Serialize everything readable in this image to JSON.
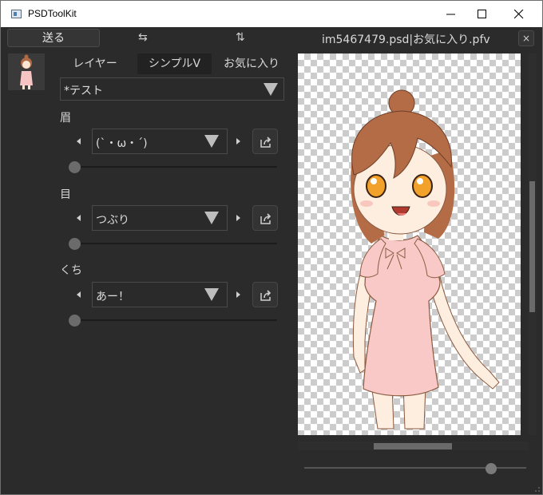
{
  "window": {
    "title": "PSDToolKit"
  },
  "toolbar": {
    "send_label": "送る",
    "swap_horizontal_glyph": "⇆",
    "swap_vertical_glyph": "⇅",
    "file_title": "im5467479.psd|お気に入り.pfv",
    "close_glyph": "×"
  },
  "tabs": [
    {
      "label": "レイヤー"
    },
    {
      "label": "シンプルV"
    },
    {
      "label": "お気に入り"
    }
  ],
  "preset": {
    "value": "*テスト"
  },
  "sections": [
    {
      "label": "眉",
      "value": "(`・ω・´)",
      "slider": 0
    },
    {
      "label": "目",
      "value": "つぶり",
      "slider": 0
    },
    {
      "label": "くち",
      "value": "あー！",
      "slider": 0
    }
  ],
  "view": {
    "zoom_level": 0.84
  },
  "icons": {
    "app": "psdtoolkit-app-icon",
    "minimize": "minimize-icon",
    "maximize": "maximize-icon",
    "close": "close-icon",
    "prev": "chevron-left-icon",
    "next": "chevron-right-icon",
    "share": "share-icon",
    "dropdown": "triangle-down-icon"
  },
  "colors": {
    "background": "#2b2b2b",
    "panel_dark": "#222222",
    "text": "#d8d8d8",
    "scroll": "#6a6a6a"
  }
}
